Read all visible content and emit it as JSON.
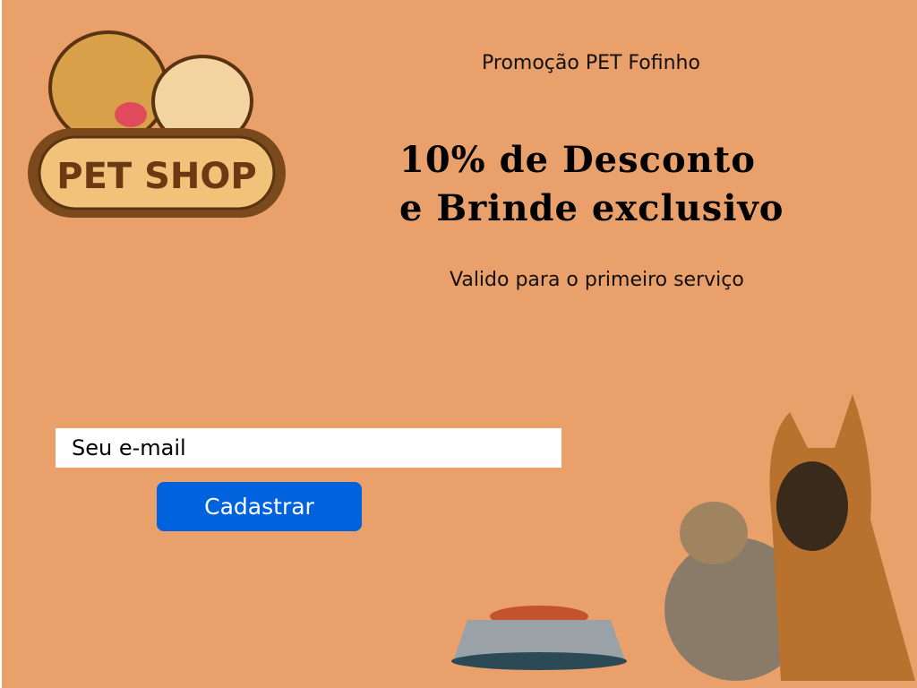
{
  "logo": {
    "text": "PET SHOP"
  },
  "promo": {
    "title": "Promoção PET Fofinho",
    "headline_line1": "10% de Desconto",
    "headline_line2": "e Brinde exclusivo",
    "subtitle": "Valido para o primeiro serviço"
  },
  "form": {
    "email_placeholder": "Seu e-mail",
    "submit_label": "Cadastrar"
  },
  "colors": {
    "background": "#e9a06b",
    "button": "#0062dc"
  }
}
